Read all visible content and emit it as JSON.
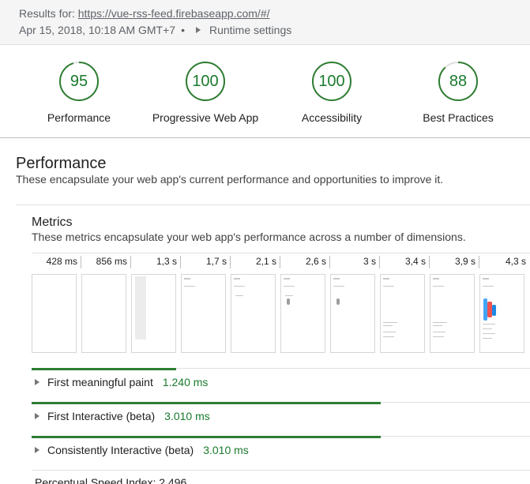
{
  "header": {
    "results_label": "Results for:",
    "url": "https://vue-rss-feed.firebaseapp.com/#/",
    "timestamp": "Apr 15, 2018, 10:18 AM GMT+7",
    "separator": "•",
    "runtime_settings": "Runtime settings"
  },
  "scores": [
    {
      "value": "95",
      "label": "Performance",
      "fraction": 0.95
    },
    {
      "value": "100",
      "label": "Progressive Web App",
      "fraction": 1.0
    },
    {
      "value": "100",
      "label": "Accessibility",
      "fraction": 1.0
    },
    {
      "value": "88",
      "label": "Best Practices",
      "fraction": 0.88
    }
  ],
  "colors": {
    "pass": "#2e7d32",
    "track": "#e0e0e0"
  },
  "performance": {
    "title": "Performance",
    "description": "These encapsulate your web app's current performance and opportunities to improve it."
  },
  "metrics": {
    "title": "Metrics",
    "description": "These metrics encapsulate your web app's performance across a number of dimensions.",
    "timeline_ticks": [
      "428 ms",
      "856 ms",
      "1,3 s",
      "1,7 s",
      "2,1 s",
      "2,6 s",
      "3 s",
      "3,4 s",
      "3,9 s",
      "4,3 s"
    ],
    "items": [
      {
        "label": "First meaningful paint",
        "value": "1.240 ms",
        "fill": 0.29
      },
      {
        "label": "First Interactive (beta)",
        "value": "3.010 ms",
        "fill": 0.7
      },
      {
        "label": "Consistently Interactive (beta)",
        "value": "3.010 ms",
        "fill": 0.7
      },
      {
        "label": "Perceptual Speed Index: 2.496",
        "value": "",
        "fill": 0
      }
    ]
  }
}
